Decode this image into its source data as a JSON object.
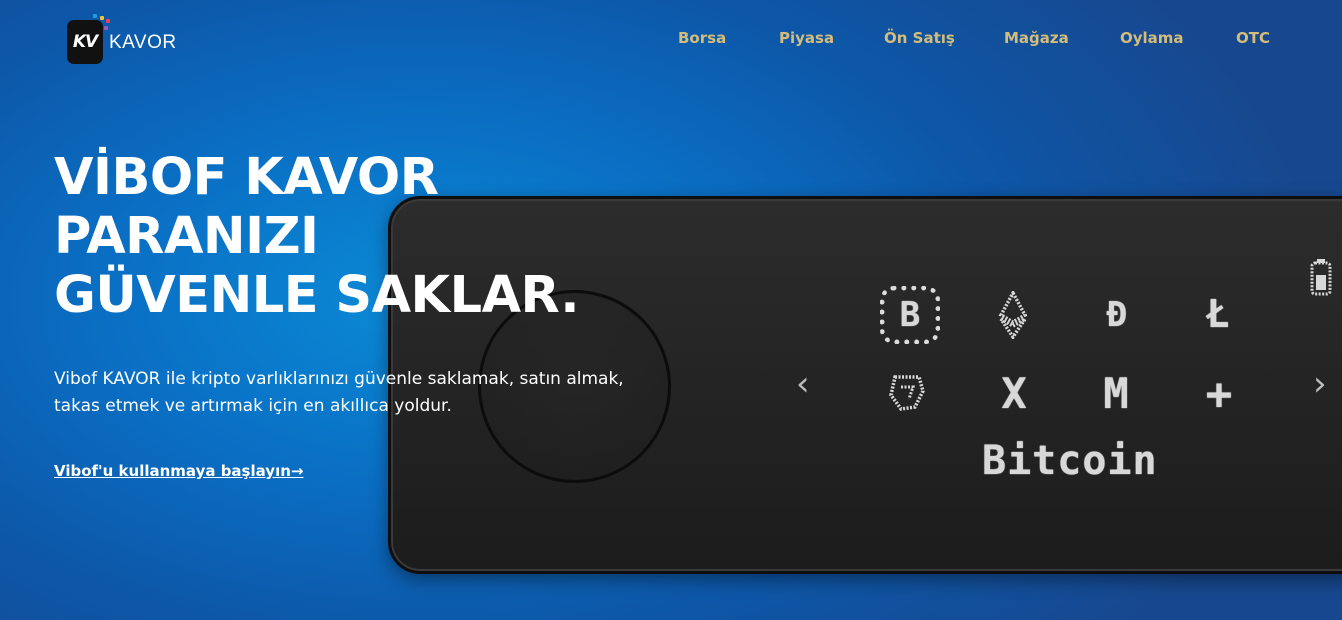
{
  "brand": {
    "logo_mark": "KV",
    "name": "KAVOR",
    "dot_colors": [
      "#e9434f",
      "#1c9fe5",
      "#f3c23b",
      "#9b59b6"
    ]
  },
  "nav": {
    "items": [
      "Borsa",
      "Piyasa",
      "Ön Satış",
      "Mağaza",
      "Oylama",
      "OTC"
    ],
    "color": "#d4bd7a"
  },
  "hero": {
    "title_lines": [
      "VİBOF KAVOR",
      "PARANIZI",
      "GÜVENLE SAKLAR."
    ],
    "description_lines": [
      "Vibof KAVOR ile kripto varlıklarınızı güvenle saklamak, satın almak,",
      "takas etmek ve artırmak için en akıllıca yoldur."
    ],
    "cta": "Vibof'u kullanmaya başlayın→"
  },
  "device": {
    "selected_coin_label": "Bitcoin",
    "coin_icons": [
      "bitcoin-icon",
      "ethereum-icon",
      "dogecoin-icon",
      "litecoin-icon",
      "tezos-icon",
      "ripple-icon",
      "monero-icon",
      "add-icon",
      "battery-icon"
    ],
    "left_arrow": "‹",
    "right_arrow": "›"
  }
}
